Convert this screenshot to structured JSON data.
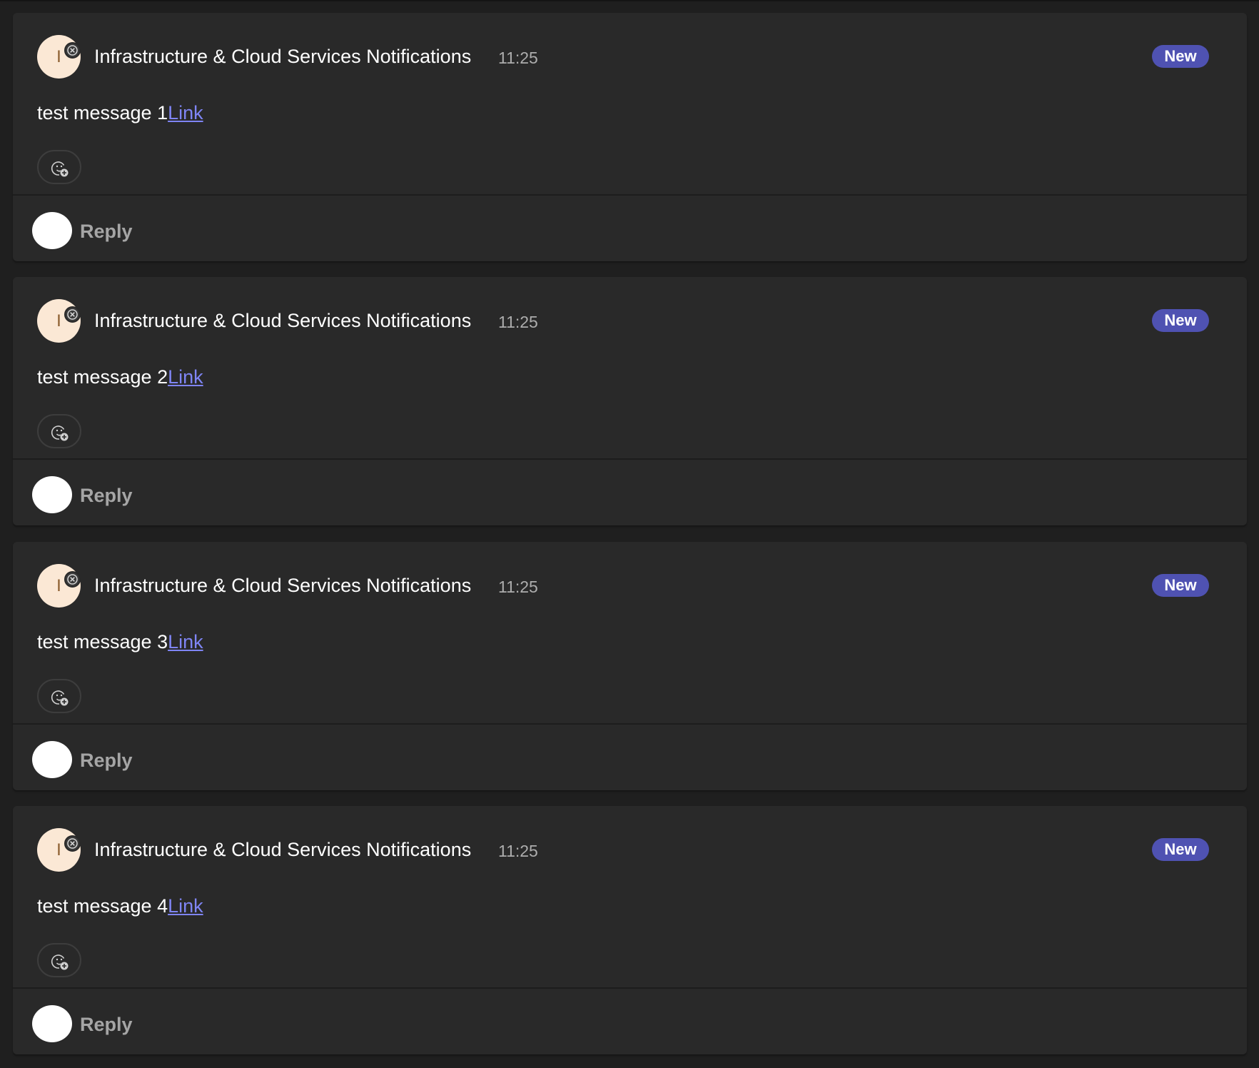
{
  "messages": [
    {
      "avatar_initial": "I",
      "sender": "Infrastructure & Cloud Services Notifications",
      "time": "11:25",
      "badge": "New",
      "text": "test message 1",
      "link_label": "Link",
      "reply_label": "Reply"
    },
    {
      "avatar_initial": "I",
      "sender": "Infrastructure & Cloud Services Notifications",
      "time": "11:25",
      "badge": "New",
      "text": "test message 2",
      "link_label": "Link",
      "reply_label": "Reply"
    },
    {
      "avatar_initial": "I",
      "sender": "Infrastructure & Cloud Services Notifications",
      "time": "11:25",
      "badge": "New",
      "text": "test message 3",
      "link_label": "Link",
      "reply_label": "Reply"
    },
    {
      "avatar_initial": "I",
      "sender": "Infrastructure & Cloud Services Notifications",
      "time": "11:25",
      "badge": "New",
      "text": "test message 4",
      "link_label": "Link",
      "reply_label": "Reply"
    }
  ],
  "icons": {
    "status": "presence-offline-icon",
    "reaction": "add-reaction-icon"
  },
  "colors": {
    "background": "#1f1f1f",
    "card": "#292929",
    "accent_badge": "#4f52b2",
    "link": "#7f85f5",
    "avatar_bg": "#fbe8d5"
  }
}
